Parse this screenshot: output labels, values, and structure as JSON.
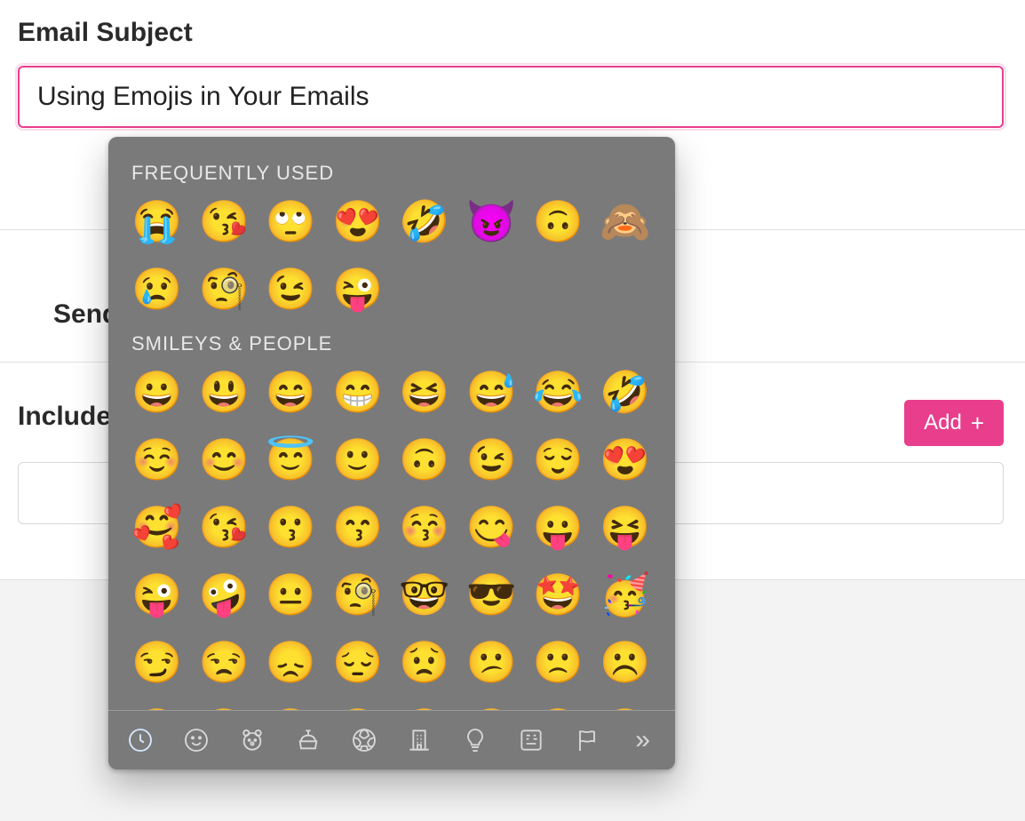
{
  "subject": {
    "label": "Email Subject",
    "value": "Using Emojis in Your Emails"
  },
  "send": {
    "label": "Send"
  },
  "include": {
    "label": "Include",
    "add_button": "Add"
  },
  "emoji_picker": {
    "sections": {
      "frequent": {
        "title": "FREQUENTLY USED",
        "items": [
          "😭",
          "😘",
          "🙄",
          "😍",
          "🤣",
          "😈",
          "🙃",
          "🙈",
          "😢",
          "🧐",
          "😉",
          "😜"
        ]
      },
      "smileys": {
        "title": "SMILEYS & PEOPLE",
        "items": [
          "😀",
          "😃",
          "😄",
          "😁",
          "😆",
          "😅",
          "😂",
          "🤣",
          "☺️",
          "😊",
          "😇",
          "🙂",
          "🙃",
          "😉",
          "😌",
          "😍",
          "🥰",
          "😘",
          "😗",
          "😙",
          "😚",
          "😋",
          "😛",
          "😝",
          "😜",
          "🤪",
          "😐",
          "🧐",
          "🤓",
          "😎",
          "🤩",
          "🥳",
          "😏",
          "😒",
          "😞",
          "😔",
          "😟",
          "😕",
          "🙁",
          "☹️",
          "😣",
          "😖",
          "😫",
          "😩",
          "🥺",
          "😢",
          "😭",
          "😤"
        ]
      }
    },
    "categories": [
      {
        "name": "recent",
        "icon": "clock"
      },
      {
        "name": "smileys",
        "icon": "smiley"
      },
      {
        "name": "animals",
        "icon": "bear"
      },
      {
        "name": "food",
        "icon": "food"
      },
      {
        "name": "activity",
        "icon": "soccer"
      },
      {
        "name": "travel",
        "icon": "building"
      },
      {
        "name": "objects",
        "icon": "bulb"
      },
      {
        "name": "symbols",
        "icon": "symbols"
      },
      {
        "name": "flags",
        "icon": "flag"
      },
      {
        "name": "more",
        "icon": "chevrons"
      }
    ]
  }
}
